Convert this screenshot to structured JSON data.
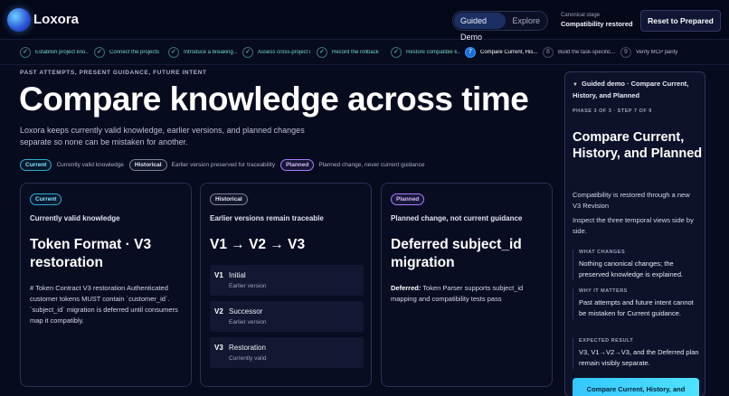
{
  "header": {
    "brand": "Loxora",
    "mode_tabs": [
      {
        "label": "Guided Demo",
        "active": true
      },
      {
        "label": "Explore",
        "active": false
      }
    ],
    "stage_label": "Canonical stage",
    "stage_value": "Compatibility restored",
    "reset_label": "Reset to Prepared"
  },
  "steps": [
    {
      "label": "Establish project kno...",
      "state": "done",
      "mark": "✓"
    },
    {
      "label": "Connect the projects",
      "state": "done",
      "mark": "✓"
    },
    {
      "label": "Introduce a breaking...",
      "state": "done",
      "mark": "✓"
    },
    {
      "label": "Assess cross-project i...",
      "state": "done",
      "mark": "✓"
    },
    {
      "label": "Record the rollback",
      "state": "done",
      "mark": "✓"
    },
    {
      "label": "Restore compatible k...",
      "state": "done",
      "mark": "✓"
    },
    {
      "label": "Compare Current, His...",
      "state": "current",
      "mark": "7"
    },
    {
      "label": "Build the task-specific...",
      "state": "future",
      "mark": "8"
    },
    {
      "label": "Verify MCP parity",
      "state": "future",
      "mark": "9"
    }
  ],
  "main": {
    "eyebrow": "PAST ATTEMPTS, PRESENT GUIDANCE, FUTURE INTENT",
    "title": "Compare knowledge across time",
    "intro": "Loxora keeps currently valid knowledge, earlier versions, and planned changes separate so none can be mistaken for another.",
    "legend": [
      {
        "pill": "Current",
        "text": "Currently valid knowledge",
        "kind": "current"
      },
      {
        "pill": "Historical",
        "text": "Earlier version preserved for traceability",
        "kind": "historical"
      },
      {
        "pill": "Planned",
        "text": "Planned change, never current guidance",
        "kind": "planned"
      }
    ]
  },
  "cards": {
    "current": {
      "pill": "Current",
      "subtitle": "Currently valid knowledge",
      "heading": "Token Format · V3 restoration",
      "body": "# Token Contract V3 restoration Authenticated customer tokens MUST contain `customer_id`. `subject_id` migration is deferred until consumers map it compatibly."
    },
    "historical": {
      "pill": "Historical",
      "subtitle": "Earlier versions remain traceable",
      "heading": "V1 → V2 → V3",
      "versions": [
        {
          "id": "V1",
          "name": "Initial",
          "status": "Earlier version"
        },
        {
          "id": "V2",
          "name": "Successor",
          "status": "Earlier version"
        },
        {
          "id": "V3",
          "name": "Restoration",
          "status": "Currently valid"
        }
      ]
    },
    "planned": {
      "pill": "Planned",
      "subtitle": "Planned change, not current guidance",
      "heading": "Deferred subject_id migration",
      "body_label": "Deferred:",
      "body": " Token Parser supports subject_id mapping and compatibility tests pass"
    }
  },
  "panel": {
    "caret": "▼",
    "header": "Guided demo · Compare Current, History, and Planned",
    "phase": "PHASE 3 OF 3 · STEP 7 OF 9",
    "title": "Compare Current, History, and Planned",
    "p1": "Compatibility is restored through a new V3 Revision",
    "p2": "Inspect the three temporal views side by side.",
    "sections": [
      {
        "key": "WHAT CHANGES",
        "value": "Nothing canonical changes; the preserved knowledge is explained."
      },
      {
        "key": "WHY IT MATTERS",
        "value": "Past attempts and future intent cannot be mistaken for Current guidance."
      },
      {
        "key": "EXPECTED RESULT",
        "value": "V3, V1→V2→V3, and the Deferred plan remain visibly separate."
      }
    ],
    "cta": "Compare Current, History, and"
  }
}
